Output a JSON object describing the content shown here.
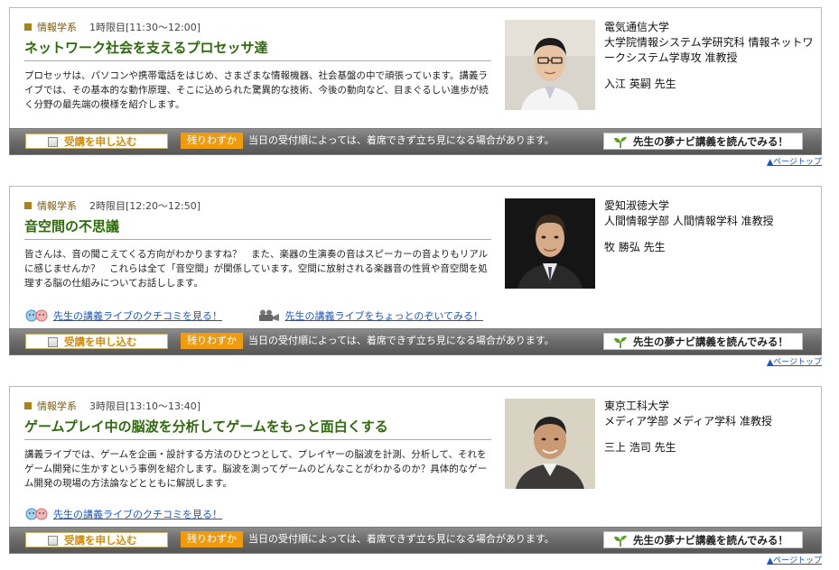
{
  "lectures": [
    {
      "subject": "情報学系",
      "period": "1時限目[11:30～12:00]",
      "title": "ネットワーク社会を支えるプロセッサ達",
      "desc": "プロセッサは、パソコンや携帯電話をはじめ、さまざまな情報機器、社会基盤の中で頑張っています。講義ライブでは、その基本的な動作原理、そこに込められた驚異的な技術、今後の動向など、目まぐるしい進歩が続く分野の最先端の模様を紹介します。",
      "institution": "電気通信大学\n大学院情報システム学研究科 情報ネットワークシステム学専攻 准教授",
      "name": "入江 英嗣 先生",
      "links": []
    },
    {
      "subject": "情報学系",
      "period": "2時限目[12:20～12:50]",
      "title": "音空間の不思議",
      "desc": "皆さんは、音の聞こえてくる方向がわかりますね？　また、楽器の生演奏の音はスピーカーの音よりもリアルに感じませんか？　これらは全て「音空間」が関係しています。空間に放射される楽器音の性質や音空間を処理する脳の仕組みについてお話しします。",
      "institution": "愛知淑徳大学\n人間情報学部 人間情報学科 准教授",
      "name": "牧 勝弘 先生",
      "links": [
        {
          "label": "先生の講義ライブのクチコミを見る！",
          "icon": "kuchikomi-icon"
        },
        {
          "label": "先生の講義ライブをちょっとのぞいてみる！",
          "icon": "video-camera-icon"
        }
      ]
    },
    {
      "subject": "情報学系",
      "period": "3時限目[13:10～13:40]",
      "title": "ゲームプレイ中の脳波を分析してゲームをもっと面白くする",
      "desc": "講義ライブでは、ゲームを企画・設計する方法のひとつとして、プレイヤーの脳波を計測、分析して、それをゲーム開発に生かすという事例を紹介します。脳波を測ってゲームのどんなことがわかるのか？具体的なゲーム開発の現場の方法論などとともに解説します。",
      "institution": "東京工科大学\nメディア学部 メディア学科 准教授",
      "name": "三上 浩司 先生",
      "links": [
        {
          "label": "先生の講義ライブのクチコミを見る！",
          "icon": "kuchikomi-icon"
        }
      ]
    }
  ],
  "common": {
    "apply_label": "受講を申し込む",
    "badge": "残りわずか",
    "notice": "当日の受付順によっては、着席できず立ち見になる場合があります。",
    "yume_label": "先生の夢ナビ講義を読んでみる！",
    "pagetop": "▲ページトップ"
  },
  "colors": {
    "title_green": "#2f6a0d",
    "subject_gold": "#a9821a",
    "badge_orange": "#f09a0e",
    "link_blue": "#1a56c8"
  }
}
